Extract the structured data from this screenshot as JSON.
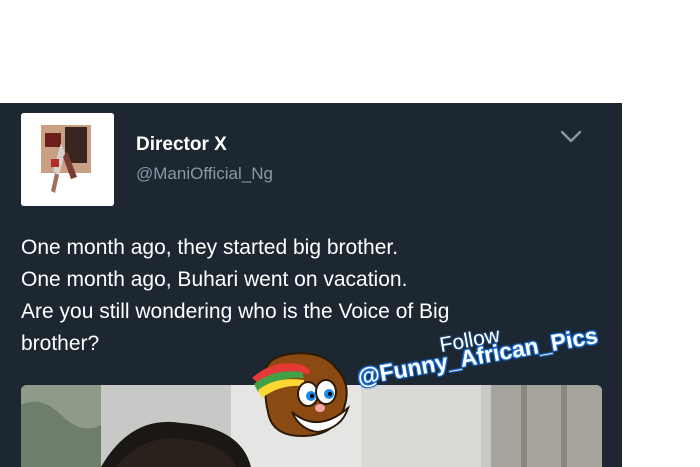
{
  "tweet": {
    "display_name": "Director X",
    "handle": "@ManiOfficial_Ng",
    "text_lines": [
      "One month ago, they started big brother.",
      "One month ago, Buhari went on vacation.",
      "Are you still wondering who is the Voice of Big",
      "brother?"
    ]
  },
  "watermark": {
    "follow_label": "Follow",
    "handle": "@Funny_African_Pics"
  },
  "icons": {
    "menu": "chevron-down-icon",
    "mascot": "mascot-logo"
  },
  "colors": {
    "card_background": "#1c2731",
    "text_primary": "#ffffff",
    "text_secondary": "#8899a6",
    "watermark_blue": "#1b6fd1"
  }
}
